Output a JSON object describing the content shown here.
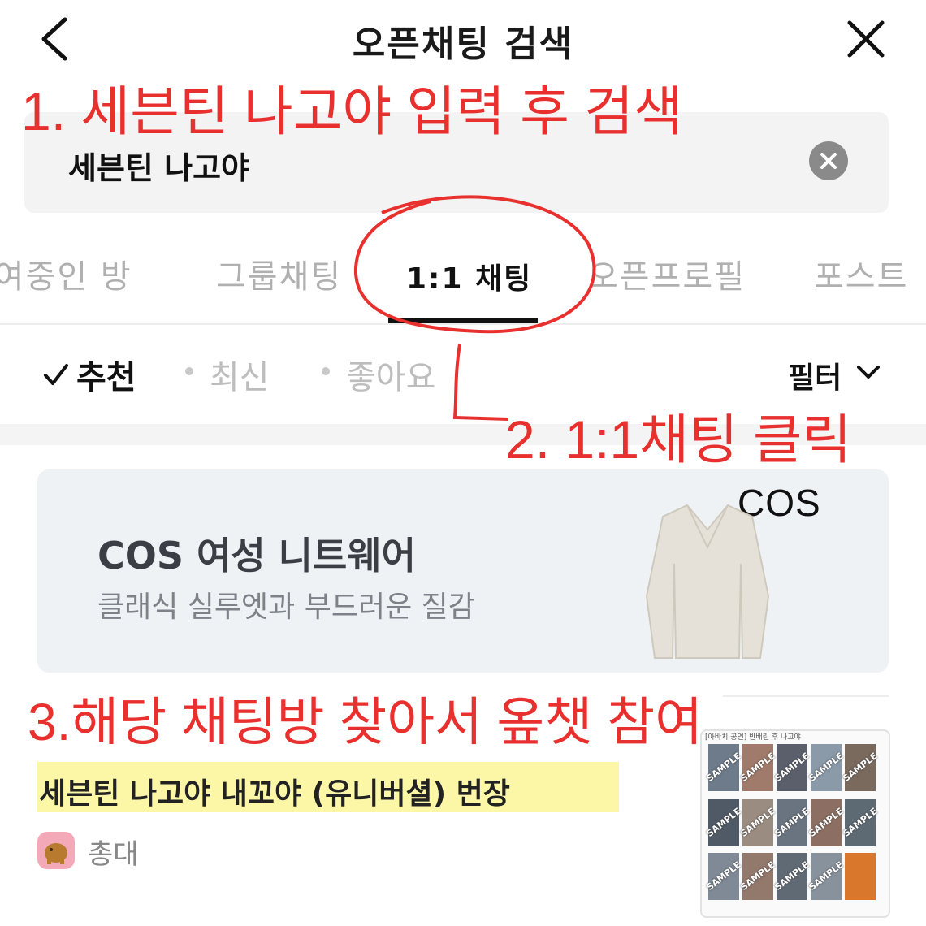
{
  "header": {
    "title": "오픈채팅 검색"
  },
  "search": {
    "value": "세븐틴 나고야"
  },
  "tabs": [
    {
      "label": "참여중인 방"
    },
    {
      "label": "그룹채팅"
    },
    {
      "label": "1:1 채팅",
      "active": true
    },
    {
      "label": "오픈프로필"
    },
    {
      "label": "포스트"
    }
  ],
  "sort": {
    "options": [
      {
        "label": "추천",
        "active": true
      },
      {
        "label": "최신"
      },
      {
        "label": "좋아요"
      }
    ],
    "filter_label": "필터"
  },
  "ad": {
    "title": "COS 여성 니트웨어",
    "subtitle": "클래식 실루엣과 부드러운 질감",
    "brand": "COS"
  },
  "annotations": {
    "step1": "1. 세븐틴 나고야 입력 후 검색",
    "step2": "2. 1:1채팅 클릭",
    "step3": "3.해당 채팅방 찾아서 옾챗 참여"
  },
  "result": {
    "title": "세븐틴 나고야 내꼬야 (유니버셜) 번장",
    "author": "총대",
    "thumbnail_caption": "[아바치 공연] 반배린 후 나고야",
    "watermark": "SAMPLE"
  },
  "colors": {
    "annotation_red": "#e8302e",
    "highlight_yellow": "#fbf7a7",
    "ad_background": "#eef2f5",
    "active_text": "#111111",
    "inactive_text": "#b0b0b0"
  },
  "icons": [
    "back-arrow-icon",
    "close-icon",
    "clear-icon",
    "check-icon",
    "chevron-down-icon",
    "avatar-icon"
  ]
}
